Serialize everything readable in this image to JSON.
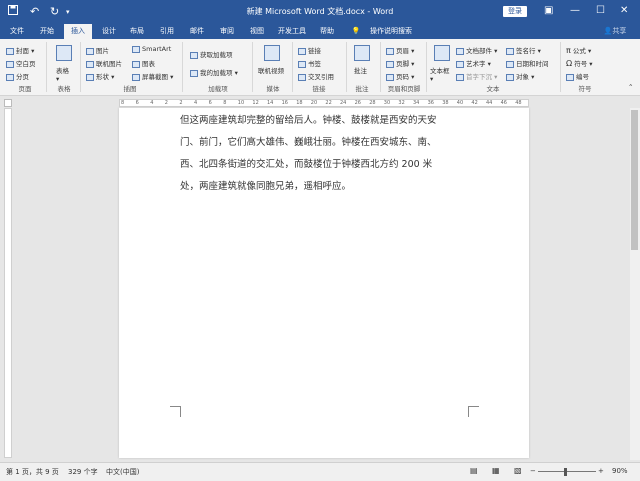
{
  "titlebar": {
    "save_icon": "save-icon",
    "undo_glyph": "↶",
    "redo_glyph": "↻",
    "title": "新建 Microsoft Word 文档.docx  -  Word",
    "login_label": "登录",
    "min_glyph": "—",
    "max_glyph": "☐",
    "close_glyph": "✕"
  },
  "tabs": [
    "文件",
    "开始",
    "插入",
    "设计",
    "布局",
    "引用",
    "邮件",
    "审阅",
    "视图",
    "开发工具",
    "帮助",
    "操作说明搜索"
  ],
  "share_label": "共享",
  "ribbon": {
    "pages": {
      "items": [
        "封面",
        "空白页",
        "分页"
      ],
      "group": "页面"
    },
    "tables": {
      "button": "表格",
      "group": "表格"
    },
    "illustrations": {
      "items": [
        "图片",
        "联机图片",
        "形状",
        "SmartArt",
        "图表",
        "屏幕截图"
      ],
      "group": "插图"
    },
    "addins": {
      "items": [
        "获取加载项",
        "我的加载项"
      ],
      "group": "加载项"
    },
    "media": {
      "button": "联机视频",
      "group": "媒体"
    },
    "links": {
      "items": [
        "链接",
        "书签",
        "交叉引用"
      ],
      "group": "链接"
    },
    "comments": {
      "button": "批注",
      "group": "批注"
    },
    "header_footer": {
      "items": [
        "页眉",
        "页脚",
        "页码"
      ],
      "group": "页眉和页脚"
    },
    "text": {
      "textbox": "文本框",
      "items": [
        "文档部件",
        "艺术字",
        "首字下沉",
        "签名行",
        "日期和时间",
        "对象"
      ],
      "group": "文本"
    },
    "symbols": {
      "items": [
        "公式",
        "符号",
        "编号"
      ],
      "group": "符号"
    }
  },
  "ruler_numbers": [
    "8",
    "6",
    "4",
    "2",
    "2",
    "4",
    "6",
    "8",
    "10",
    "12",
    "14",
    "16",
    "18",
    "20",
    "22",
    "24",
    "26",
    "28",
    "30",
    "32",
    "34",
    "36",
    "38",
    "40",
    "42",
    "44",
    "46",
    "48"
  ],
  "document": {
    "lines": [
      "但这两座建筑却完整的留给后人。钟楼、鼓楼就是西安的天安",
      "门、前门，它们高大雄伟、巍峨壮丽。钟楼在西安城东、南、",
      "西、北四条街道的交汇处，而鼓楼位于钟楼西北方约 200 米",
      "处，两座建筑就像同胞兄弟，遥相呼应。"
    ]
  },
  "status": {
    "page": "第 1 页，共 9 页",
    "words": "329 个字",
    "language": "中文(中国)",
    "zoom": "90%"
  }
}
